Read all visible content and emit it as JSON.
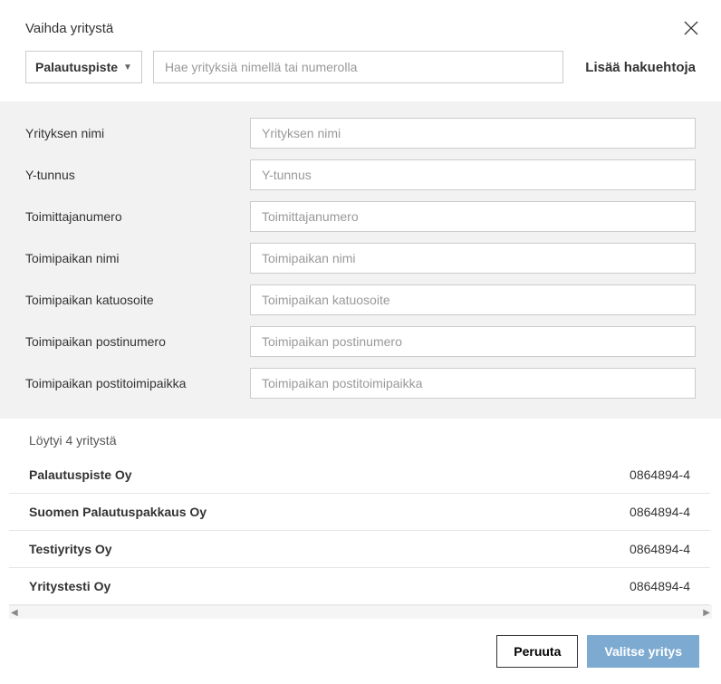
{
  "header": {
    "title": "Vaihda yritystä"
  },
  "search": {
    "dropdown_label": "Palautuspiste",
    "placeholder": "Hae yrityksiä nimellä tai numerolla",
    "more_options_label": "Lisää hakuehtoja"
  },
  "form": {
    "fields": [
      {
        "label": "Yrityksen nimi",
        "placeholder": "Yrityksen nimi"
      },
      {
        "label": "Y-tunnus",
        "placeholder": "Y-tunnus"
      },
      {
        "label": "Toimittajanumero",
        "placeholder": "Toimittajanumero"
      },
      {
        "label": "Toimipaikan nimi",
        "placeholder": "Toimipaikan nimi"
      },
      {
        "label": "Toimipaikan katuosoite",
        "placeholder": "Toimipaikan katuosoite"
      },
      {
        "label": "Toimipaikan postinumero",
        "placeholder": "Toimipaikan postinumero"
      },
      {
        "label": "Toimipaikan postitoimipaikka",
        "placeholder": "Toimipaikan postitoimipaikka"
      }
    ]
  },
  "results": {
    "count_text": "Löytyi 4 yritystä",
    "items": [
      {
        "name": "Palautuspiste Oy",
        "id": "0864894-4"
      },
      {
        "name": "Suomen Palautuspakkaus Oy",
        "id": "0864894-4"
      },
      {
        "name": "Testiyritys Oy",
        "id": "0864894-4"
      },
      {
        "name": "Yritystesti Oy",
        "id": "0864894-4"
      }
    ]
  },
  "footer": {
    "cancel_label": "Peruuta",
    "select_label": "Valitse yritys"
  }
}
